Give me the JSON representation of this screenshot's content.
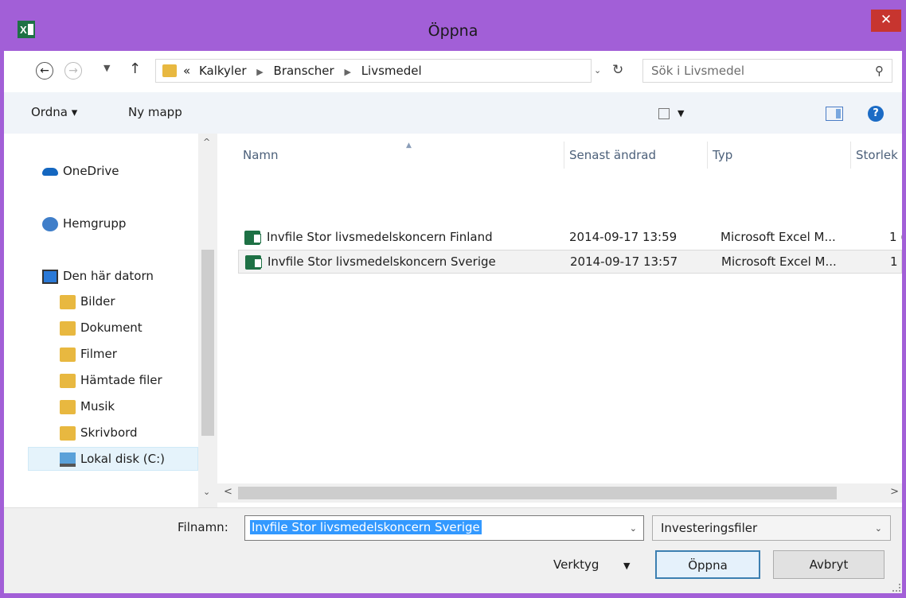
{
  "window": {
    "title": "Öppna",
    "app_icon": "excel-icon",
    "close_label": "✕",
    "titlebar_color": "#a25fd7"
  },
  "address": {
    "crumb_prefix": "«",
    "crumbs": [
      "Kalkyler",
      "Branscher",
      "Livsmedel"
    ],
    "search_placeholder": "Sök i Livsmedel"
  },
  "toolbar": {
    "organize_label": "Ordna ▾",
    "new_folder_label": "Ny mapp"
  },
  "sidebar": {
    "items": [
      {
        "label": "OneDrive",
        "icon": "onedrive-icon"
      },
      {
        "label": "Hemgrupp",
        "icon": "homegroup-icon"
      },
      {
        "label": "Den här datorn",
        "icon": "computer-icon"
      },
      {
        "label": "Bilder",
        "icon": "pictures-folder-icon"
      },
      {
        "label": "Dokument",
        "icon": "documents-folder-icon"
      },
      {
        "label": "Filmer",
        "icon": "videos-folder-icon"
      },
      {
        "label": "Hämtade filer",
        "icon": "downloads-folder-icon"
      },
      {
        "label": "Musik",
        "icon": "music-folder-icon"
      },
      {
        "label": "Skrivbord",
        "icon": "desktop-folder-icon"
      },
      {
        "label": "Lokal disk (C:)",
        "icon": "local-disk-icon",
        "selected": true
      }
    ]
  },
  "filelist": {
    "columns": [
      "Namn",
      "Senast ändrad",
      "Typ",
      "Storlek"
    ],
    "sort_column": "Namn",
    "rows": [
      {
        "name": "Invfile Stor livsmedelskoncern Finland",
        "modified": "2014-09-17 13:59",
        "type": "Microsoft Excel M...",
        "size": "1 (",
        "selected": false
      },
      {
        "name": "Invfile Stor livsmedelskoncern Sverige",
        "modified": "2014-09-17 13:57",
        "type": "Microsoft Excel M...",
        "size": "1 (",
        "selected": true
      }
    ]
  },
  "bottom": {
    "filename_label": "Filnamn:",
    "filename_value": "Invfile Stor livsmedelskoncern Sverige",
    "filter_value": "Investeringsfiler",
    "tools_label": "Verktyg",
    "open_label": "Öppna",
    "cancel_label": "Avbryt"
  }
}
